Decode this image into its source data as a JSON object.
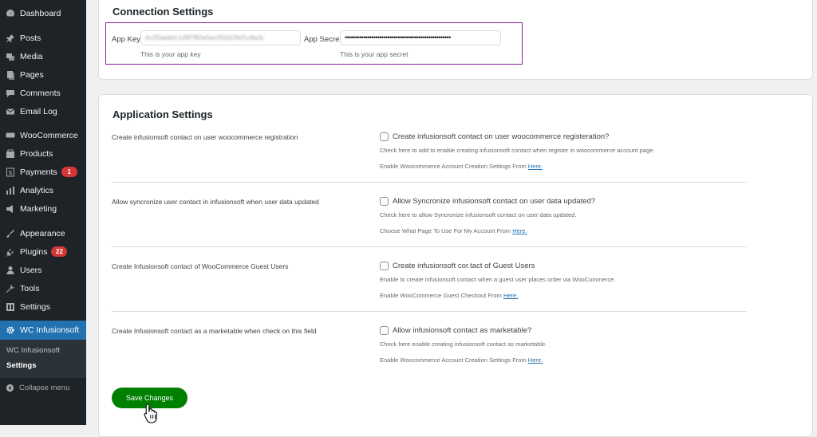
{
  "sidebar": {
    "items": [
      {
        "label": "Dashboard",
        "icon": "dashboard-icon",
        "badge": ""
      },
      {
        "label": "Posts",
        "icon": "pin-icon",
        "badge": ""
      },
      {
        "label": "Media",
        "icon": "media-icon",
        "badge": ""
      },
      {
        "label": "Pages",
        "icon": "pages-icon",
        "badge": ""
      },
      {
        "label": "Comments",
        "icon": "comment-icon",
        "badge": ""
      },
      {
        "label": "Email Log",
        "icon": "email-icon",
        "badge": ""
      },
      {
        "label": "WooCommerce",
        "icon": "woocommerce-icon",
        "badge": ""
      },
      {
        "label": "Products",
        "icon": "products-icon",
        "badge": ""
      },
      {
        "label": "Payments",
        "icon": "payments-icon",
        "badge": "1"
      },
      {
        "label": "Analytics",
        "icon": "analytics-icon",
        "badge": ""
      },
      {
        "label": "Marketing",
        "icon": "megaphone-icon",
        "badge": ""
      },
      {
        "label": "Appearance",
        "icon": "brush-icon",
        "badge": ""
      },
      {
        "label": "Plugins",
        "icon": "plugin-icon",
        "badge": "22"
      },
      {
        "label": "Users",
        "icon": "users-icon",
        "badge": ""
      },
      {
        "label": "Tools",
        "icon": "wrench-icon",
        "badge": ""
      },
      {
        "label": "Settings",
        "icon": "settings-icon",
        "badge": ""
      },
      {
        "label": "WC Infusionsoft",
        "icon": "gear-icon",
        "badge": ""
      }
    ],
    "submenu": [
      "WC Infusionsoft",
      "Settings"
    ],
    "collapse_label": "Collapse menu"
  },
  "connection": {
    "title": "Connection Settings",
    "app_key_label": "App Key",
    "app_key_value": "4c2f3aeb0c1d9f7f63e5ac0f2d1f3ef1c8a3c",
    "app_key_hint": "This is your app key",
    "app_secret_label": "App Secret",
    "app_secret_value": "••••••••••••••••••••••••••••••••••••••••••••••••••••",
    "app_secret_hint": "This is your app secret"
  },
  "application": {
    "title": "Application Settings",
    "rows": [
      {
        "label": "Create infusionsoft contact on user woocommerce registration",
        "checkbox_label": "Create infusionsoft contact on user woocommerce registeration?",
        "help": "Check here to add to enable creating infusionsoft contact when register in woocommerce account page.",
        "link_prefix": "Enable Woocommerce Account Creation Settings From",
        "link_text": "Here."
      },
      {
        "label": "Allow syncronize user contact in infusionsoft when user data updated",
        "checkbox_label": "Allow Syncronize infusionsoft contact on user data updated?",
        "help": "Check here to allow Syncronize infusionsoft contact on user data updated.",
        "link_prefix": "Choose What Page To Use For My Account From",
        "link_text": "Here."
      },
      {
        "label": "Create Infusionsoft contact of WooCommerce Guest Users",
        "checkbox_label": "Create infusionsoft cor.tact of Guest Users",
        "help": "Enable to create infusionsoft contact when a guest user places order via WooCommerce.",
        "link_prefix": "Enable WooCommerce Guest Checkout From",
        "link_text": "Here."
      },
      {
        "label": "Create Infusionsoft contact as a marketable when check on this field",
        "checkbox_label": "Allow infusionsoft contact as marketable?",
        "help": "Check here enable creating infusionsoft contact as marketable.",
        "link_prefix": "Enable Woocommerce Account Creation Settings From",
        "link_text": "Here."
      }
    ],
    "save_label": "Save Changes"
  },
  "colors": {
    "sidebar_bg": "#1d2327",
    "active_menu": "#2271b1",
    "highlight_border": "#8c1f9e",
    "save_button": "#008000",
    "badge": "#d63638"
  }
}
